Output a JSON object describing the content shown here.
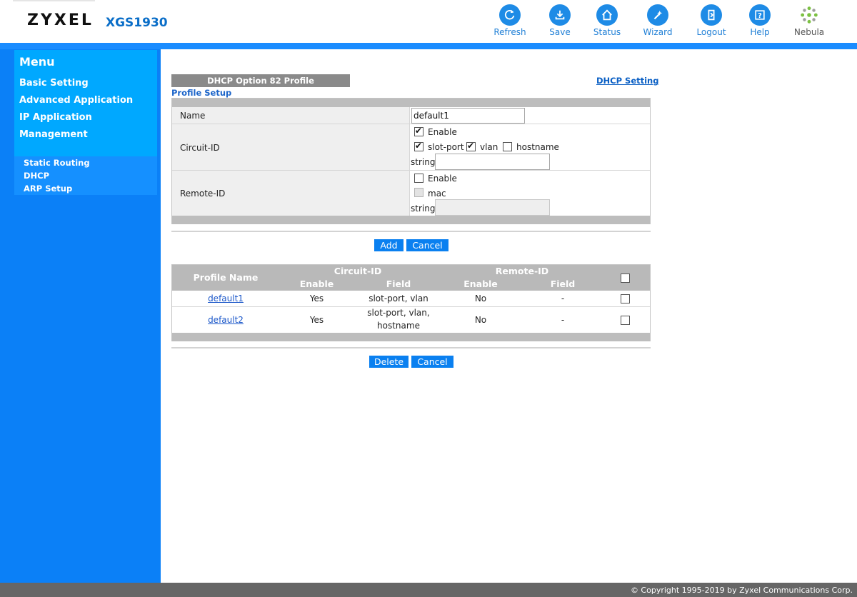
{
  "header": {
    "brand": "ZYXEL",
    "model": "XGS1930",
    "toolbar": [
      {
        "label": "Refresh",
        "icon": "refresh-icon"
      },
      {
        "label": "Save",
        "icon": "save-icon"
      },
      {
        "label": "Status",
        "icon": "status-icon"
      },
      {
        "label": "Wizard",
        "icon": "wizard-icon"
      },
      {
        "label": "Logout",
        "icon": "logout-icon"
      },
      {
        "label": "Help",
        "icon": "help-icon"
      },
      {
        "label": "Nebula",
        "icon": "nebula-icon"
      }
    ]
  },
  "sidebar": {
    "title": "Menu",
    "items": [
      "Basic Setting",
      "Advanced Application",
      "IP Application",
      "Management"
    ],
    "sub_items": [
      "Static Routing",
      "DHCP",
      "ARP Setup"
    ]
  },
  "page": {
    "tab_title": "DHCP Option 82 Profile",
    "link": "DHCP Setting",
    "section": "Profile Setup"
  },
  "form": {
    "name_label": "Name",
    "name_value": "default1",
    "circuit_label": "Circuit-ID",
    "circuit_enable": {
      "label": "Enable",
      "checked": true
    },
    "circuit_slot_port": {
      "label": "slot-port",
      "checked": true
    },
    "circuit_vlan": {
      "label": "vlan",
      "checked": true
    },
    "circuit_hostname": {
      "label": "hostname",
      "checked": false
    },
    "circuit_string_label": "string",
    "circuit_string_value": "",
    "remote_label": "Remote-ID",
    "remote_enable": {
      "label": "Enable",
      "checked": false
    },
    "remote_mac": {
      "label": "mac",
      "checked": false,
      "disabled": true
    },
    "remote_string_label": "string",
    "remote_string_value": ""
  },
  "form_buttons": {
    "add": "Add",
    "cancel": "Cancel"
  },
  "list": {
    "headers": {
      "profile_name": "Profile Name",
      "circuit_id": "Circuit-ID",
      "remote_id": "Remote-ID",
      "enable": "Enable",
      "field": "Field"
    },
    "rows": [
      {
        "name": "default1",
        "c_enable": "Yes",
        "c_field": "slot-port, vlan",
        "r_enable": "No",
        "r_field": "-"
      },
      {
        "name": "default2",
        "c_enable": "Yes",
        "c_field_line1": "slot-port, vlan,",
        "c_field_line2": "hostname",
        "r_enable": "No",
        "r_field": "-"
      }
    ]
  },
  "list_buttons": {
    "delete": "Delete",
    "cancel": "Cancel"
  },
  "footer": {
    "copyright": "© Copyright 1995-2019 by Zyxel Communications Corp."
  },
  "colors": {
    "accent": "#0b80f7",
    "menu_top": "#00a8ff",
    "link": "#1b57c9"
  }
}
